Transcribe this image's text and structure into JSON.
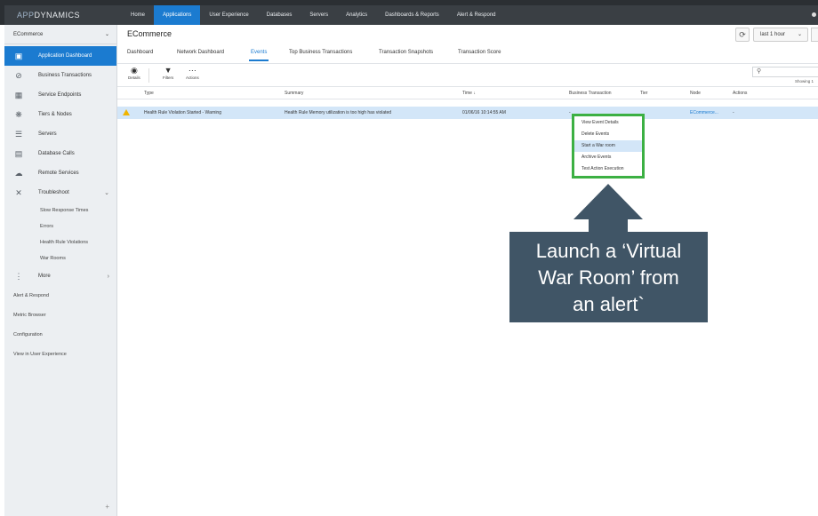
{
  "app": {
    "logo_prefix": "APP",
    "logo_suffix": "DYNAMICS"
  },
  "nav": {
    "items": [
      "Home",
      "Applications",
      "User Experience",
      "Databases",
      "Servers",
      "Analytics",
      "Dashboards & Reports",
      "Alert & Respond"
    ],
    "active": "Applications"
  },
  "sidebar": {
    "app_selector": "ECommerce",
    "items": [
      {
        "label": "Application Dashboard",
        "icon": "dashboard-icon"
      },
      {
        "label": "Business Transactions",
        "icon": "business-transactions-icon"
      },
      {
        "label": "Service Endpoints",
        "icon": "service-endpoints-icon"
      },
      {
        "label": "Tiers & Nodes",
        "icon": "tiers-nodes-icon"
      },
      {
        "label": "Servers",
        "icon": "servers-icon"
      },
      {
        "label": "Database Calls",
        "icon": "database-icon"
      },
      {
        "label": "Remote Services",
        "icon": "remote-services-icon"
      },
      {
        "label": "Troubleshoot",
        "icon": "wrench-icon"
      }
    ],
    "troubleshoot_sub": [
      "Slow Response Times",
      "Errors",
      "Health Rule Violations",
      "War Rooms"
    ],
    "more": "More",
    "plain": [
      "Alert & Respond",
      "Metric Browser",
      "Configuration",
      "View in User Experience"
    ],
    "collapse": "+"
  },
  "main": {
    "title": "ECommerce",
    "range": "last 1 hour",
    "tabs": [
      "Dashboard",
      "Network Dashboard",
      "Events",
      "Top Business Transactions",
      "Transaction Snapshots",
      "Transaction Score"
    ],
    "active_tab": "Events",
    "toolbar": {
      "details": "Details",
      "filters": "Filters",
      "actions": "Actions"
    },
    "showing": "Showing 1",
    "columns": [
      "Type",
      "Summary",
      "Time ↓",
      "Business Transaction",
      "Tier",
      "Node",
      "Actions"
    ],
    "row": {
      "type": "Health Rule Violation Started - Warning",
      "summary": "Health Rule Memory utilization is too high has violated",
      "time": "01/06/16 10:14:55 AM",
      "bt": "-",
      "node": "ECommerce...",
      "actions": "-"
    }
  },
  "context_menu": {
    "items": [
      "View Event Details",
      "Delete Events",
      "Start a War room",
      "Archive Events",
      "Test Action Execution"
    ],
    "highlighted": 2
  },
  "callout": {
    "lines": [
      "Launch a ‘Virtual",
      "War Room’ from",
      "an alert`"
    ]
  },
  "colors": {
    "accent": "#1b7bd0",
    "menu_border": "#3cb043",
    "callout": "#405566",
    "warning": "#f0b400"
  }
}
